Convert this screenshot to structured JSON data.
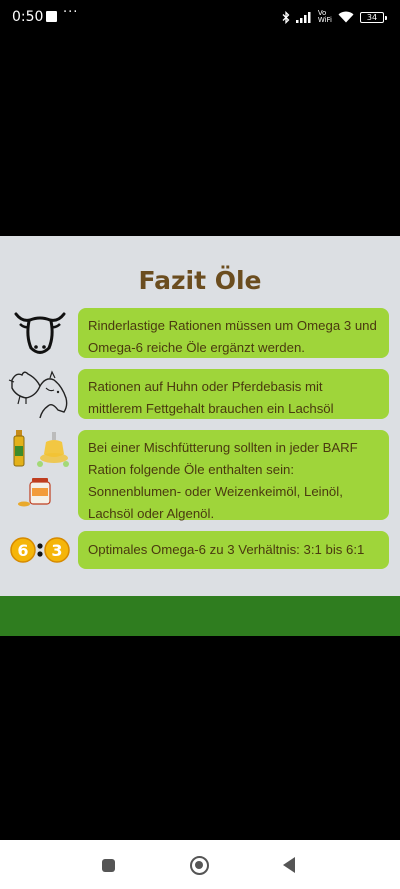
{
  "status_bar": {
    "time": "0:50",
    "more": "···",
    "vowifi_top": "Vo",
    "vowifi_bottom": "WiFi",
    "battery": "34"
  },
  "slide": {
    "title": "Fazit Öle",
    "rows": [
      {
        "icon": "cow-head-icon",
        "text": "Rinderlastige Rationen müssen um Omega 3 und Omega-6 reiche Öle ergänzt werden."
      },
      {
        "icon": "chicken-horse-icon",
        "text": "Rationen auf Huhn oder Pferdebasis mit mittlerem Fettgehalt brauchen ein Lachsöl"
      },
      {
        "icon": "oil-bottles-icon",
        "text": "Bei einer Mischfütterung sollten in jeder BARF Ration folgende Öle enthalten sein: Sonnenblumen- oder Weizenkeimöl, Leinöl, Lachsöl oder Algenöl."
      },
      {
        "icon": "ratio-6-3-icon",
        "text": "Optimales Omega-6 zu 3 Verhältnis: 3:1 bis 6:1",
        "ratio_left": "6",
        "ratio_right": "3"
      }
    ]
  },
  "colors": {
    "title": "#6b4d1f",
    "box": "#9fd53a",
    "band": "#2f7d1f",
    "slide_bg": "#dcdfe3"
  }
}
